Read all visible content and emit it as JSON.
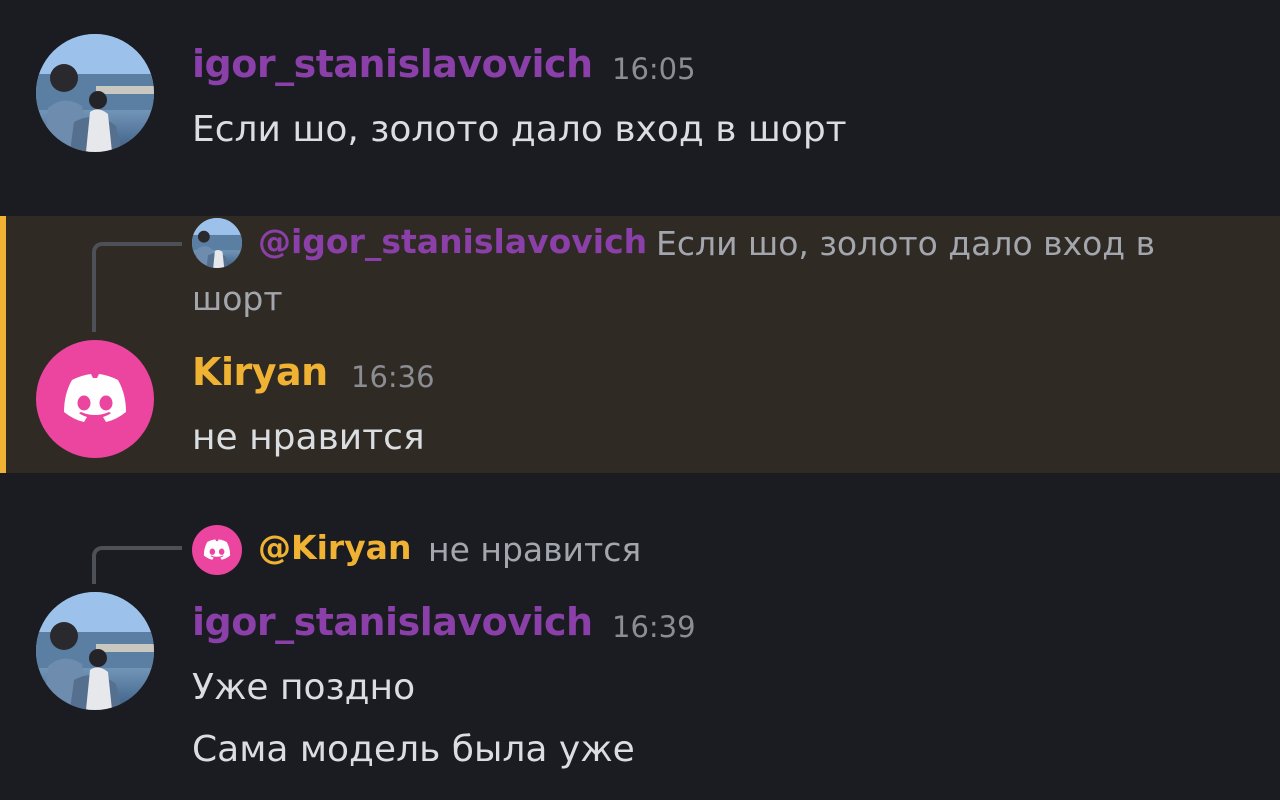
{
  "messages": [
    {
      "author": "igor_stanislavovich",
      "time": "16:05",
      "lines": [
        "Если шо, золото дало вход в шорт"
      ]
    },
    {
      "author": "Kiryan",
      "time": "16:36",
      "reply": {
        "mention": "@igor_stanislavovich",
        "text": "Если шо, золото дало вход в",
        "text_cont": "шорт"
      },
      "lines": [
        "не нравится"
      ]
    },
    {
      "author": "igor_stanislavovich",
      "time": "16:39",
      "reply": {
        "mention": "@Kiryan",
        "text": "не нравится"
      },
      "lines": [
        "Уже поздно",
        "Сама модель была уже"
      ]
    }
  ],
  "colors": {
    "background": "#1b1c21",
    "igor_name": "#8b3fa8",
    "kiryan_name": "#f0b232",
    "mention_highlight": "#302a25",
    "discord_avatar": "#eb459f"
  }
}
